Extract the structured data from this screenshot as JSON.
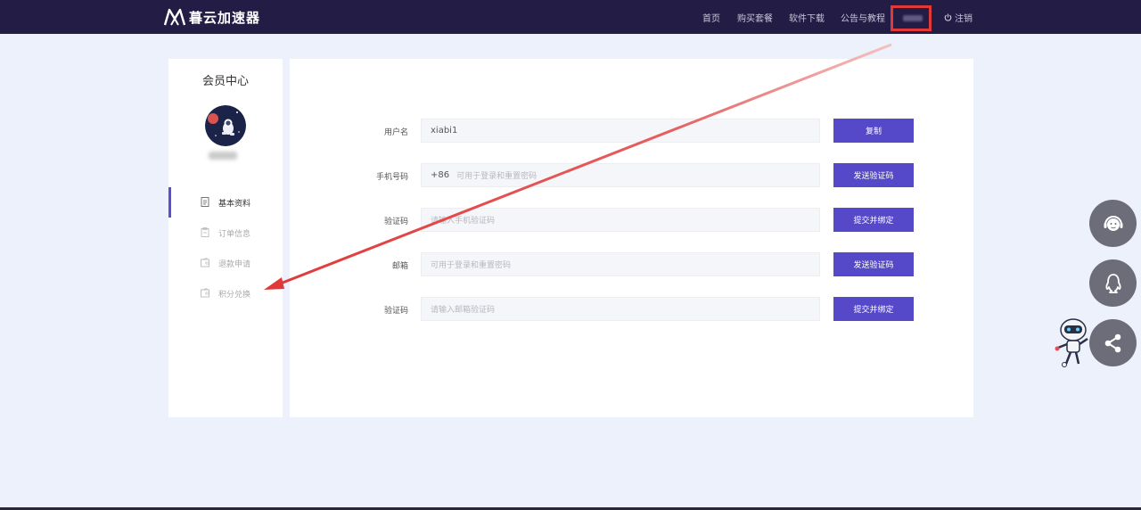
{
  "header": {
    "brand": "暮云加速器",
    "nav": [
      "首页",
      "购买套餐",
      "软件下载",
      "公告与教程"
    ],
    "logout_label": "注销",
    "colors": {
      "bar": "#231c45",
      "accent": "#5548c9",
      "highlight": "#e23838"
    }
  },
  "sidebar": {
    "title": "会员中心",
    "avatar_icon": "astronaut-avatar",
    "menu": [
      {
        "label": "基本资料",
        "icon": "document-icon",
        "active": true
      },
      {
        "label": "订单信息",
        "icon": "clipboard-icon",
        "active": false
      },
      {
        "label": "退款申请",
        "icon": "wallet-icon",
        "active": false
      },
      {
        "label": "积分兑换",
        "icon": "wallet-icon",
        "active": false
      }
    ]
  },
  "form": {
    "username": {
      "label": "用户名",
      "value": "xiabi1",
      "button": "复制"
    },
    "phone": {
      "label": "手机号码",
      "prefix": "+86",
      "placeholder": "可用于登录和重置密码",
      "button": "发送验证码"
    },
    "phone_code": {
      "label": "验证码",
      "placeholder": "请输入手机验证码",
      "button": "提交并绑定"
    },
    "email": {
      "label": "邮箱",
      "placeholder": "可用于登录和重置密码",
      "button": "发送验证码"
    },
    "email_code": {
      "label": "验证码",
      "placeholder": "请输入邮箱验证码",
      "button": "提交并绑定"
    }
  },
  "widgets": {
    "icons": [
      "customer-service-icon",
      "qq-icon",
      "share-icon",
      "robot-mascot"
    ]
  }
}
